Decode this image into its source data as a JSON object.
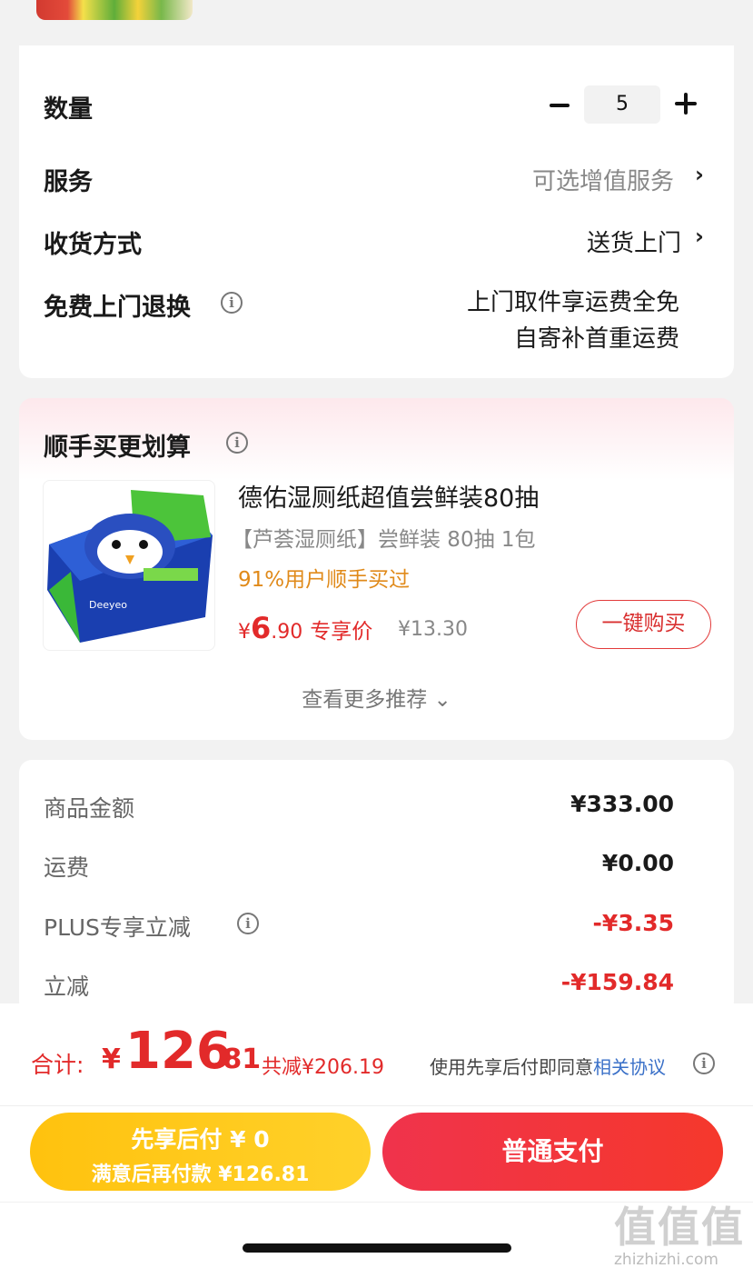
{
  "order": {
    "quantity_label": "数量",
    "quantity_value": "5",
    "service_label": "服务",
    "service_value": "可选增值服务",
    "delivery_label": "收货方式",
    "delivery_value": "送货上门",
    "return_label": "免费上门退换",
    "return_line1": "上门取件享运费全免",
    "return_line2": "自寄补首重运费"
  },
  "recommend": {
    "title": "顺手买更划算",
    "product_name": "德佑湿厕纸超值尝鲜装80抽",
    "product_spec": "【芦荟湿厕纸】尝鲜装 80抽 1包",
    "social_proof": "91%用户顺手买过",
    "price_symbol": "¥",
    "price_int": "6",
    "price_dec": ".90",
    "price_tag": "专享价",
    "original_price": "¥13.30",
    "buy_button": "一键购买",
    "more_link": "查看更多推荐 ⌄"
  },
  "summary": {
    "goods_label": "商品金额",
    "goods_value": "¥333.00",
    "shipping_label": "运费",
    "shipping_value": "¥0.00",
    "plus_label": "PLUS专享立减",
    "plus_value": "-¥3.35",
    "discount_label": "立减",
    "discount_value": "-¥159.84"
  },
  "footer": {
    "total_label": "合计:",
    "total_yen": "¥",
    "total_int": "126",
    "total_dec": ".81",
    "total_saved": "共减¥206.19",
    "agree_prefix": "使用先享后付即同意",
    "agree_link": "相关协议",
    "pay_later_line1": "先享后付 ¥ 0",
    "pay_later_line2": "满意后再付款 ¥126.81",
    "pay_now": "普通支付",
    "watermark_logo": "值值值",
    "watermark_url": "zhizhizhi.com"
  },
  "colors": {
    "accent_red": "#e22a2a",
    "pay_later_yellow": "#ffc20e",
    "social_orange": "#e08a1a",
    "link_blue": "#3a70c8"
  }
}
